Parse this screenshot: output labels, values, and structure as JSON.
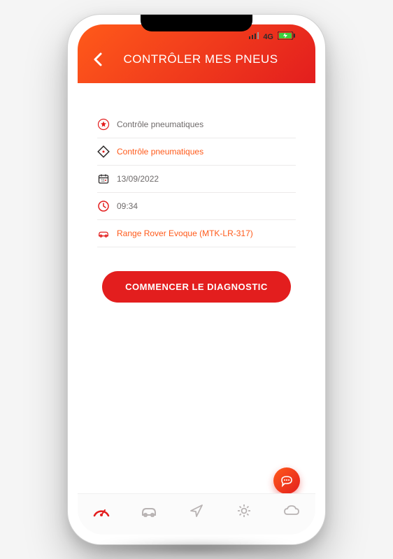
{
  "status": {
    "network": "4G"
  },
  "header": {
    "title": "CONTRÔLER MES PNEUS"
  },
  "info": {
    "control_title": "Contrôle pneumatiques",
    "control_type": "Contrôle pneumatiques",
    "date": "13/09/2022",
    "time": "09:34",
    "vehicle": "Range Rover Evoque (MTK-LR-317)"
  },
  "cta": {
    "label": "COMMENCER LE DIAGNOSTIC"
  },
  "colors": {
    "primary": "#e31e1e",
    "accent": "#ff5a1a"
  }
}
